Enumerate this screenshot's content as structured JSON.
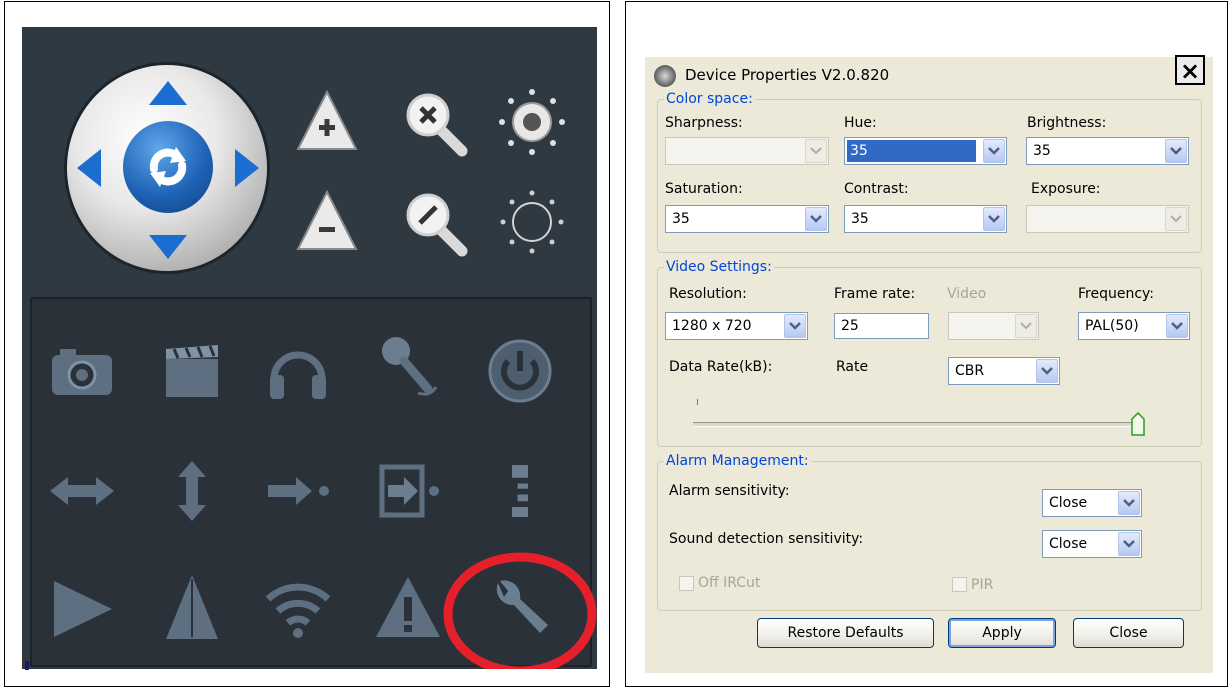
{
  "left_panel": {
    "ptz_icons": [
      "pan-tilt-refresh-icon",
      "focus-plus-icon",
      "focus-minus-icon",
      "zoom-in-icon",
      "zoom-out-icon",
      "brightness-up-icon",
      "brightness-down-icon"
    ],
    "grid_icons": [
      [
        "camera-icon",
        "clapperboard-icon",
        "headphones-icon",
        "microphone-icon",
        "power-icon"
      ],
      [
        "horizontal-arrows-icon",
        "vertical-arrows-icon",
        "right-arrow-dot-icon",
        "enter-arrow-icon",
        "e-letter-icon"
      ],
      [
        "flag-right-icon",
        "triangle-icon",
        "wifi-icon",
        "warning-icon",
        "wrench-icon"
      ]
    ],
    "highlight_color": "#e6202a",
    "e_letter": "E"
  },
  "dialog": {
    "title": "Device Properties V2.0.820",
    "close_symbol": "×",
    "color_space": {
      "legend": "Color space:",
      "sharpness_label": "Sharpness:",
      "sharpness_value": "",
      "hue_label": "Hue:",
      "hue_value": "35",
      "brightness_label": "Brightness:",
      "brightness_value": "35",
      "saturation_label": "Saturation:",
      "saturation_value": "35",
      "contrast_label": "Contrast:",
      "contrast_value": "35",
      "exposure_label": "Exposure:",
      "exposure_value": ""
    },
    "video_settings": {
      "legend": "Video Settings:",
      "resolution_label": "Resolution:",
      "resolution_value": "1280 x 720",
      "frame_rate_label": "Frame rate:",
      "frame_rate_value": "25",
      "video_label": "Video",
      "video_value": "",
      "frequency_label": "Frequency:",
      "frequency_value": "PAL(50)",
      "data_rate_label": "Data Rate(kB):",
      "rate_label": "Rate",
      "rate_value": "CBR",
      "data_rate_slider_fraction": 1.0
    },
    "alarm_management": {
      "legend": "Alarm Management:",
      "alarm_sensitivity_label": "Alarm sensitivity:",
      "alarm_sensitivity_value": "Close",
      "sound_detection_label": "Sound detection sensitivity:",
      "sound_detection_value": "Close",
      "off_ircut_label": "Off IRCut",
      "pir_label": "PIR"
    },
    "buttons": {
      "restore_defaults": "Restore Defaults",
      "apply": "Apply",
      "close": "Close"
    }
  }
}
